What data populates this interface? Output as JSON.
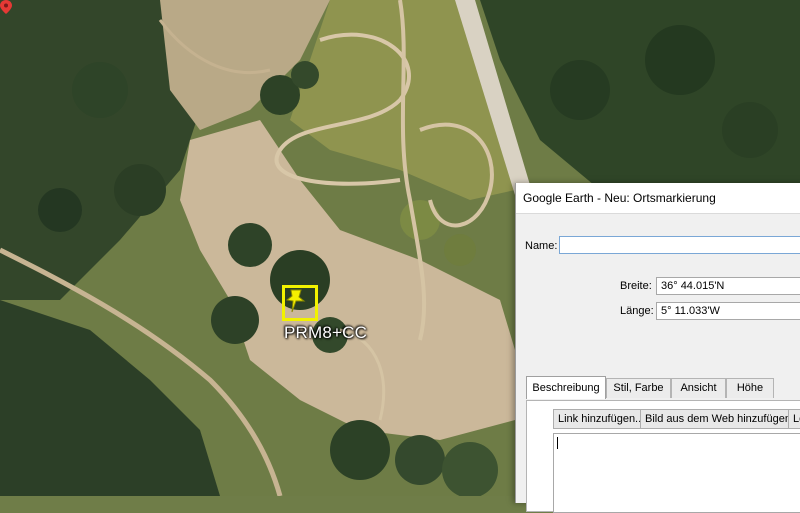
{
  "map": {
    "plus_code": "PRM8+CC"
  },
  "dialog": {
    "title": "Google Earth - Neu: Ortsmarkierung",
    "name_label": "Name:",
    "name_value": "",
    "latitude_label": "Breite:",
    "latitude_value": "36° 44.015'N",
    "longitude_label": "Länge:",
    "longitude_value": "5° 11.033'W",
    "tabs": [
      {
        "label": "Beschreibung",
        "active": true
      },
      {
        "label": "Stil, Farbe",
        "active": false
      },
      {
        "label": "Ansicht",
        "active": false
      },
      {
        "label": "Höhe",
        "active": false
      }
    ],
    "buttons": {
      "add_link": "Link hinzufügen...",
      "add_web_image": "Bild aus dem Web hinzufügen...",
      "add_local_image": "Lo"
    },
    "description_value": ""
  },
  "colors": {
    "pin_highlight": "#f2f200",
    "name_field_focus": "#7aa7d6"
  }
}
